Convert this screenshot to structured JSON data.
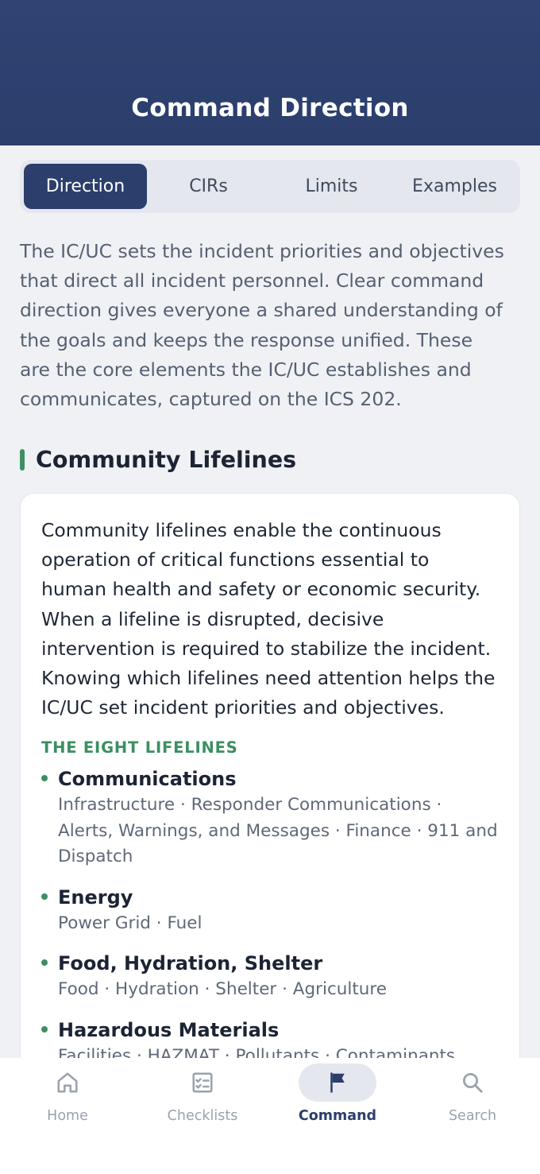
{
  "header": {
    "title": "Command Direction"
  },
  "tabs": [
    {
      "label": "Direction",
      "active": true
    },
    {
      "label": "CIRs",
      "active": false
    },
    {
      "label": "Limits",
      "active": false
    },
    {
      "label": "Examples",
      "active": false
    }
  ],
  "intro": "The IC/UC sets the incident priorities and objectives that direct all incident personnel. Clear command direction gives everyone a shared understanding of the goals and keeps the response unified. These are the core elements the IC/UC establishes and communicates, captured on the ICS 202.",
  "section": {
    "title": "Community Lifelines",
    "card_text": "Community lifelines enable the continuous operation of critical functions essential to human health and safety or economic security. When a lifeline is disrupted, decisive intervention is required to stabilize the incident. Knowing which lifelines need attention helps the IC/UC set incident priorities and objectives.",
    "list_label": "THE EIGHT LIFELINES",
    "lifelines": [
      {
        "name": "Communications",
        "subs": "Infrastructure  ·  Responder Communications  ·  Alerts, Warnings, and Messages  ·  Finance  ·  911 and Dispatch"
      },
      {
        "name": "Energy",
        "subs": "Power Grid  ·  Fuel"
      },
      {
        "name": "Food, Hydration, Shelter",
        "subs": "Food  ·  Hydration  ·  Shelter  ·  Agriculture"
      },
      {
        "name": "Hazardous Materials",
        "subs": "Facilities  ·  HAZMAT  ·  Pollutants  ·  Contaminants"
      }
    ]
  },
  "bottom_nav": [
    {
      "label": "Home",
      "icon": "home-icon",
      "active": false
    },
    {
      "label": "Checklists",
      "icon": "checklist-icon",
      "active": false
    },
    {
      "label": "Command",
      "icon": "flag-icon",
      "active": true
    },
    {
      "label": "Search",
      "icon": "search-icon",
      "active": false
    }
  ],
  "colors": {
    "primary": "#2b3e6c",
    "accent": "#3c8f62",
    "background": "#eff1f5"
  }
}
